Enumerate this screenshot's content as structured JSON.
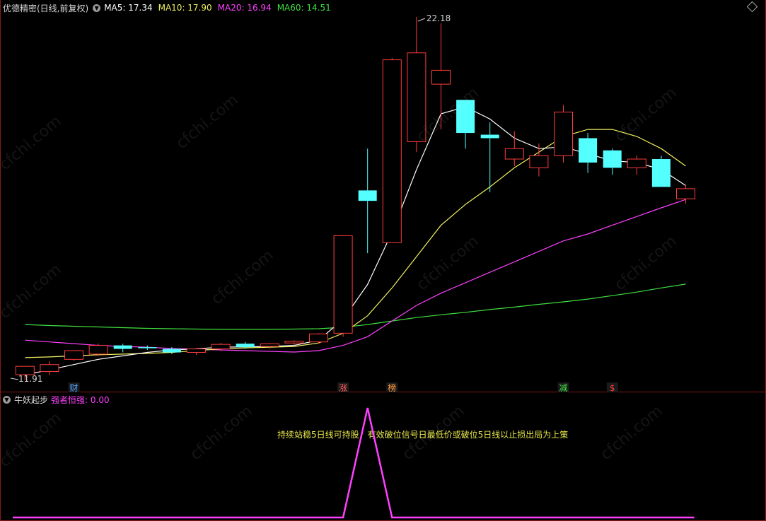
{
  "header": {
    "title": "优德精密(日线,前复权)",
    "ma": [
      {
        "label": "MA5: 17.34",
        "color": "#ffffff"
      },
      {
        "label": "MA10: 17.90",
        "color": "#f0f060"
      },
      {
        "label": "MA20: 16.94",
        "color": "#ff40ff"
      },
      {
        "label": "MA60: 14.51",
        "color": "#40e040"
      }
    ]
  },
  "indicator": {
    "title": "牛妖起步",
    "value_label": "强者恒强: 0.00",
    "value_color": "#ff40ff",
    "note": "持续站稳5日线可持股，有效破位信号日最低价或破位5日线以止损出局为上策"
  },
  "watermark": "cfchi.com",
  "chart_data": {
    "type": "candlestick",
    "colors": {
      "up": "#ff3c3c",
      "down": "#54ffff",
      "ma5": "#ffffff",
      "ma10": "#f0f060",
      "ma20": "#ff40ff",
      "ma60": "#40e040"
    },
    "high_label": "22.18",
    "low_label": "11.91",
    "candles": [
      {
        "o": 11.91,
        "h": 12.1,
        "l": 11.75,
        "c": 12.15
      },
      {
        "o": 12.0,
        "h": 12.3,
        "l": 11.9,
        "c": 12.2
      },
      {
        "o": 12.35,
        "h": 12.6,
        "l": 12.3,
        "c": 12.6
      },
      {
        "o": 12.5,
        "h": 12.8,
        "l": 12.45,
        "c": 12.75
      },
      {
        "o": 12.75,
        "h": 12.8,
        "l": 12.55,
        "c": 12.65
      },
      {
        "o": 12.7,
        "h": 12.75,
        "l": 12.62,
        "c": 12.67
      },
      {
        "o": 12.65,
        "h": 12.7,
        "l": 12.5,
        "c": 12.55
      },
      {
        "o": 12.55,
        "h": 12.68,
        "l": 12.48,
        "c": 12.65
      },
      {
        "o": 12.65,
        "h": 12.82,
        "l": 12.58,
        "c": 12.78
      },
      {
        "o": 12.8,
        "h": 12.85,
        "l": 12.65,
        "c": 12.7
      },
      {
        "o": 12.72,
        "h": 12.82,
        "l": 12.65,
        "c": 12.8
      },
      {
        "o": 12.82,
        "h": 12.9,
        "l": 12.75,
        "c": 12.87
      },
      {
        "o": 12.85,
        "h": 13.1,
        "l": 12.8,
        "c": 13.08
      },
      {
        "o": 13.1,
        "h": 15.9,
        "l": 13.0,
        "c": 15.9
      },
      {
        "o": 17.2,
        "h": 18.4,
        "l": 15.4,
        "c": 16.9
      },
      {
        "o": 15.7,
        "h": 21.0,
        "l": 15.7,
        "c": 20.95
      },
      {
        "o": 18.6,
        "h": 22.18,
        "l": 18.3,
        "c": 21.15
      },
      {
        "o": 20.25,
        "h": 22.0,
        "l": 18.95,
        "c": 20.65
      },
      {
        "o": 19.8,
        "h": 19.8,
        "l": 18.4,
        "c": 18.85
      },
      {
        "o": 18.8,
        "h": 19.15,
        "l": 17.15,
        "c": 18.7
      },
      {
        "o": 18.1,
        "h": 18.9,
        "l": 17.9,
        "c": 18.4
      },
      {
        "o": 17.85,
        "h": 18.55,
        "l": 17.6,
        "c": 18.2
      },
      {
        "o": 18.2,
        "h": 19.65,
        "l": 18.0,
        "c": 19.45
      },
      {
        "o": 18.7,
        "h": 18.85,
        "l": 17.7,
        "c": 18.0
      },
      {
        "o": 18.35,
        "h": 18.4,
        "l": 17.65,
        "c": 17.85
      },
      {
        "o": 17.85,
        "h": 18.2,
        "l": 17.65,
        "c": 18.1
      },
      {
        "o": 18.1,
        "h": 18.2,
        "l": 17.3,
        "c": 17.3
      },
      {
        "o": 16.96,
        "h": 17.35,
        "l": 16.82,
        "c": 17.25
      }
    ],
    "ma5": [
      [
        1,
        11.9
      ],
      [
        2,
        12.05
      ],
      [
        3,
        12.2
      ],
      [
        4,
        12.35
      ],
      [
        5,
        12.45
      ],
      [
        6,
        12.55
      ],
      [
        7,
        12.62
      ],
      [
        8,
        12.65
      ],
      [
        9,
        12.7
      ],
      [
        10,
        12.71
      ],
      [
        11,
        12.72
      ],
      [
        12,
        12.75
      ],
      [
        13,
        12.9
      ],
      [
        14,
        13.5
      ],
      [
        15,
        14.5
      ],
      [
        16,
        16.0
      ],
      [
        17,
        17.8
      ],
      [
        18,
        19.4
      ],
      [
        19,
        19.6
      ],
      [
        20,
        19.25
      ],
      [
        21,
        18.7
      ],
      [
        22,
        18.4
      ],
      [
        23,
        18.45
      ],
      [
        24,
        18.25
      ],
      [
        25,
        18.05
      ],
      [
        26,
        18.0
      ],
      [
        27,
        17.8
      ],
      [
        28,
        17.34
      ]
    ],
    "ma10": [
      [
        1,
        12.4
      ],
      [
        2,
        12.42
      ],
      [
        3,
        12.45
      ],
      [
        4,
        12.48
      ],
      [
        5,
        12.5
      ],
      [
        6,
        12.52
      ],
      [
        7,
        12.55
      ],
      [
        8,
        12.6
      ],
      [
        9,
        12.65
      ],
      [
        10,
        12.68
      ],
      [
        11,
        12.7
      ],
      [
        12,
        12.72
      ],
      [
        13,
        12.82
      ],
      [
        14,
        13.1
      ],
      [
        15,
        13.6
      ],
      [
        16,
        14.4
      ],
      [
        17,
        15.3
      ],
      [
        18,
        16.2
      ],
      [
        19,
        16.8
      ],
      [
        20,
        17.3
      ],
      [
        21,
        17.85
      ],
      [
        22,
        18.3
      ],
      [
        23,
        18.75
      ],
      [
        24,
        18.95
      ],
      [
        25,
        18.95
      ],
      [
        26,
        18.75
      ],
      [
        27,
        18.4
      ],
      [
        28,
        17.9
      ]
    ],
    "ma20": [
      [
        1,
        12.9
      ],
      [
        2,
        12.85
      ],
      [
        3,
        12.8
      ],
      [
        4,
        12.75
      ],
      [
        5,
        12.72
      ],
      [
        6,
        12.7
      ],
      [
        7,
        12.66
      ],
      [
        8,
        12.64
      ],
      [
        9,
        12.62
      ],
      [
        10,
        12.6
      ],
      [
        11,
        12.58
      ],
      [
        12,
        12.56
      ],
      [
        13,
        12.6
      ],
      [
        14,
        12.75
      ],
      [
        15,
        13.0
      ],
      [
        16,
        13.45
      ],
      [
        17,
        13.9
      ],
      [
        18,
        14.25
      ],
      [
        19,
        14.55
      ],
      [
        20,
        14.85
      ],
      [
        21,
        15.15
      ],
      [
        22,
        15.45
      ],
      [
        23,
        15.75
      ],
      [
        24,
        15.95
      ],
      [
        25,
        16.2
      ],
      [
        26,
        16.45
      ],
      [
        27,
        16.7
      ],
      [
        28,
        16.94
      ]
    ],
    "ma60": [
      [
        1,
        13.35
      ],
      [
        2,
        13.32
      ],
      [
        3,
        13.3
      ],
      [
        4,
        13.28
      ],
      [
        5,
        13.26
      ],
      [
        6,
        13.24
      ],
      [
        7,
        13.23
      ],
      [
        8,
        13.22
      ],
      [
        9,
        13.21
      ],
      [
        10,
        13.21
      ],
      [
        11,
        13.21
      ],
      [
        12,
        13.22
      ],
      [
        13,
        13.23
      ],
      [
        14,
        13.27
      ],
      [
        15,
        13.35
      ],
      [
        16,
        13.45
      ],
      [
        17,
        13.55
      ],
      [
        18,
        13.63
      ],
      [
        19,
        13.7
      ],
      [
        20,
        13.78
      ],
      [
        21,
        13.85
      ],
      [
        22,
        13.93
      ],
      [
        23,
        14.0
      ],
      [
        24,
        14.08
      ],
      [
        25,
        14.18
      ],
      [
        26,
        14.28
      ],
      [
        27,
        14.4
      ],
      [
        28,
        14.51
      ]
    ],
    "markers": [
      {
        "index": 3,
        "text": "财",
        "color": "#4fa0ff"
      },
      {
        "index": 14,
        "text": "涨",
        "color": "#ff5a5a"
      },
      {
        "index": 16,
        "text": "榜",
        "color": "#ff9a3c"
      },
      {
        "index": 23,
        "text": "减",
        "color": "#40e040"
      },
      {
        "index": 25,
        "text": "$",
        "color": "#ff3c3c"
      }
    ],
    "indicator_series": [
      0,
      0,
      0,
      0,
      0,
      0,
      0,
      0,
      0,
      0,
      0,
      0,
      0,
      0,
      1,
      0,
      0,
      0,
      0,
      0,
      0,
      0,
      0,
      0,
      0,
      0,
      0,
      0
    ]
  }
}
